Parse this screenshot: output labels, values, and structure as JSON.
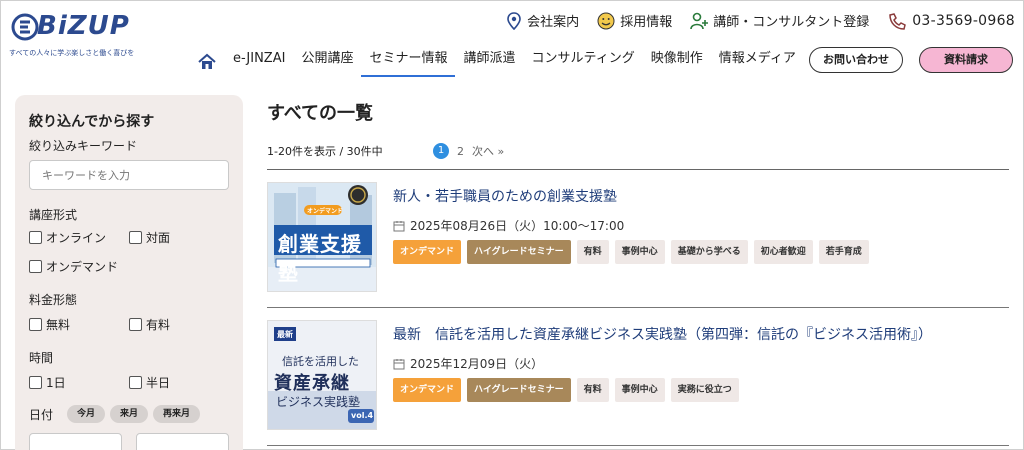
{
  "brand": {
    "name": "BiZUP",
    "tagline": "すべての人々に学ぶ楽しさと働く喜びを"
  },
  "top_links": {
    "company": "会社案内",
    "recruit": "採用情報",
    "register": "講師・コンサルタント登録",
    "phone": "03-3569-0968"
  },
  "nav": {
    "items": [
      "e-JINZAI",
      "公開講座",
      "セミナー情報",
      "講師派遣",
      "コンサルティング",
      "映像制作",
      "情報メディア"
    ],
    "active": "セミナー情報",
    "contact_label": "お問い合わせ",
    "request_label": "資料請求"
  },
  "sidebar": {
    "title": "絞り込んでから探す",
    "keyword_label": "絞り込みキーワード",
    "keyword_placeholder": "キーワードを入力",
    "format_label": "講座形式",
    "format_options": [
      "オンライン",
      "対面",
      "オンデマンド"
    ],
    "fee_label": "料金形態",
    "fee_options": [
      "無料",
      "有料"
    ],
    "time_label": "時間",
    "time_options": [
      "1日",
      "半日"
    ],
    "date_label": "日付",
    "date_pills": [
      "今月",
      "来月",
      "再来月"
    ]
  },
  "main": {
    "title": "すべての一覧",
    "count_text": "1-20件を表示 / 30件中",
    "pager": {
      "current": "1",
      "next_page": "2",
      "next_label": "次へ »"
    },
    "items": [
      {
        "title": "新人・若手職員のための創業支援塾",
        "date": "2025年08月26日（火）10:00～17:00",
        "thumb_text": "創業支援塾",
        "thumb_badge": "オンデマンド",
        "tags": [
          "オンデマンド",
          "ハイグレードセミナー",
          "有料",
          "事例中心",
          "基礎から学べる",
          "初心者歓迎",
          "若手育成"
        ]
      },
      {
        "title": "最新　信託を活用した資産承継ビジネス実践塾（第四弾：信託の『ビジネス活用術』）",
        "date": "2025年12月09日（火）",
        "thumb_badge": "最新",
        "thumb_line1": "信託を活用した",
        "thumb_line2": "資産承継",
        "thumb_line3": "ビジネス実践塾",
        "thumb_vol": "vol.4",
        "tags": [
          "オンデマンド",
          "ハイグレードセミナー",
          "有料",
          "事例中心",
          "実務に役立つ"
        ]
      }
    ]
  },
  "colors": {
    "brand": "#2c4a8f",
    "accent_blue": "#2f6fd6",
    "tag_orange": "#f5a13a",
    "tag_gold": "#a8885a",
    "request_pink": "#f6b6d3",
    "sidebar_bg": "#f2ecea"
  }
}
